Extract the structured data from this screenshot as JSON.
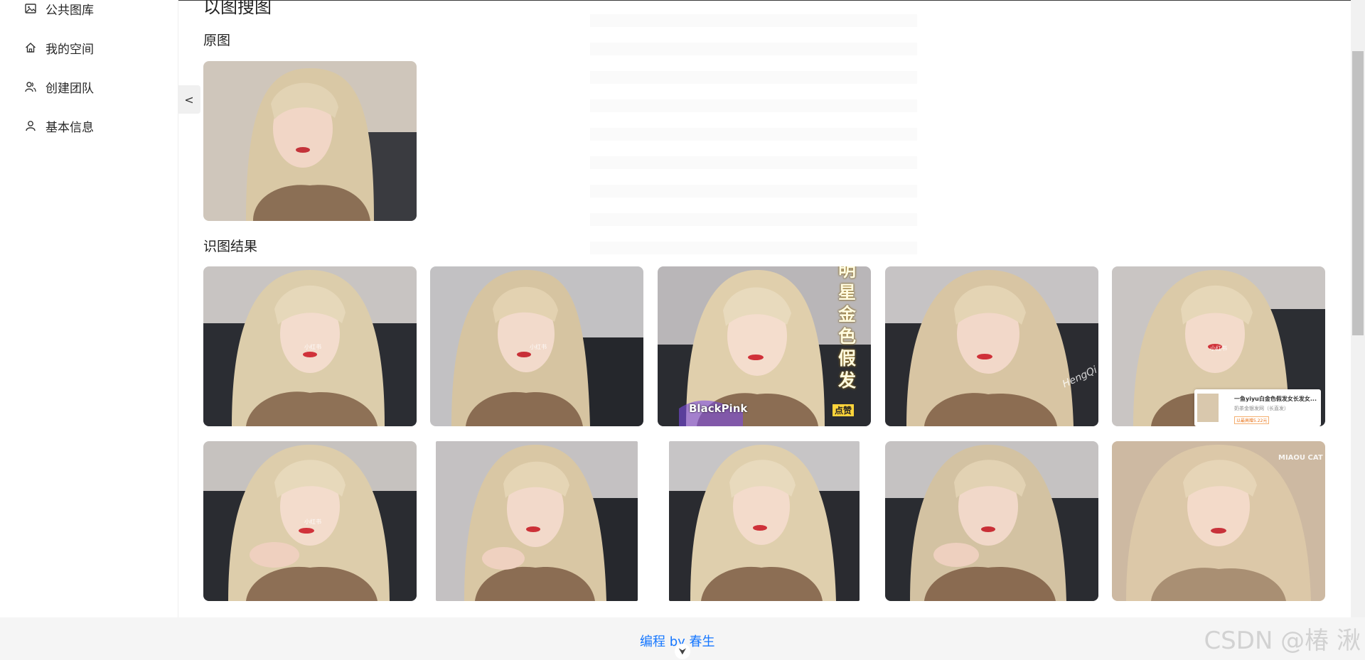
{
  "sidebar": {
    "items": [
      {
        "label": "公共图库",
        "icon": "picture-icon"
      },
      {
        "label": "我的空间",
        "icon": "home-icon"
      },
      {
        "label": "创建团队",
        "icon": "team-icon"
      },
      {
        "label": "基本信息",
        "icon": "user-icon"
      }
    ],
    "collapse_label": "<"
  },
  "main": {
    "page_title": "以图搜图",
    "original_section": "原图",
    "results_section": "识图结果"
  },
  "results": {
    "overlay_text_vertical": "明星金色假发",
    "overlay_blackpink": "BlackPink",
    "overlay_badge": "点赞",
    "watermark_hengqi": "HengQi",
    "watermark_miaou": "MIAOU CAT",
    "watermark_small": "小红书",
    "chip": {
      "title": "一鱼yiyu白金色假发女长发女...",
      "subtitle": "奶茶金银发网（长直发）",
      "price": "以最高赠5.22元"
    }
  },
  "footer": {
    "credit": "编程 by 春生",
    "arrow": "⮟",
    "watermark": "CSDN @椿  湫"
  },
  "colors": {
    "link_blue": "#1677ff",
    "footer_bg": "#f5f5f5",
    "hair_blonde": "#d8c7a6",
    "couch_dark": "#2a2c33"
  }
}
